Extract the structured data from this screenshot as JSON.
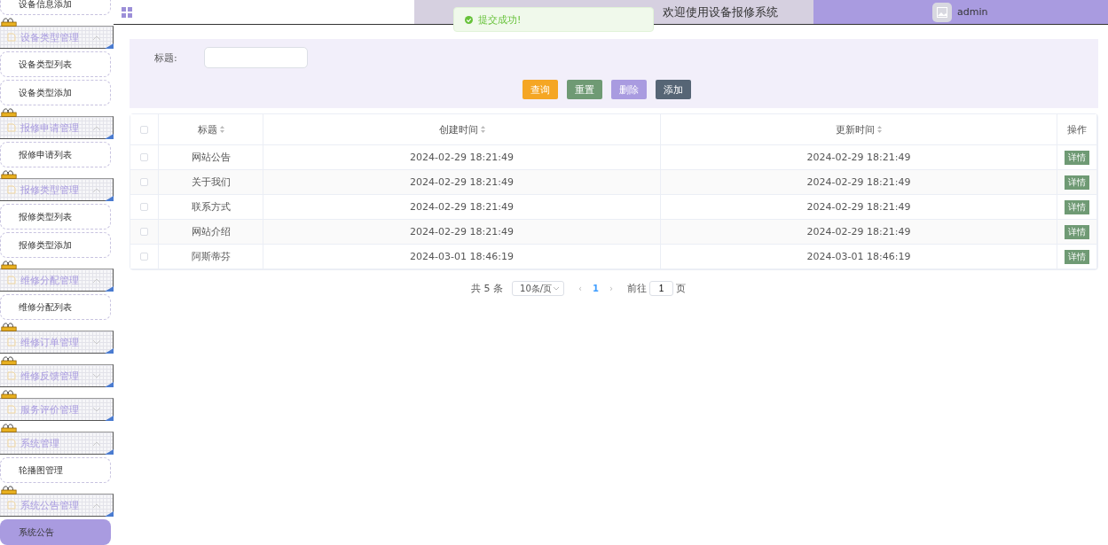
{
  "header": {
    "title": "欢迎使用设备报修系统",
    "user": "admin",
    "toast": "提交成功!"
  },
  "sidebar": [
    {
      "kind": "item",
      "label": "设备信息添加",
      "selected": false
    },
    {
      "kind": "group",
      "label": "设备类型管理",
      "expanded": true,
      "children": [
        {
          "kind": "item",
          "label": "设备类型列表",
          "selected": false
        },
        {
          "kind": "item",
          "label": "设备类型添加",
          "selected": false
        }
      ]
    },
    {
      "kind": "group",
      "label": "报修申请管理",
      "expanded": true,
      "children": [
        {
          "kind": "item",
          "label": "报修申请列表",
          "selected": false
        }
      ]
    },
    {
      "kind": "group",
      "label": "报修类型管理",
      "expanded": true,
      "children": [
        {
          "kind": "item",
          "label": "报修类型列表",
          "selected": false
        },
        {
          "kind": "item",
          "label": "报修类型添加",
          "selected": false
        }
      ]
    },
    {
      "kind": "group",
      "label": "维修分配管理",
      "expanded": true,
      "children": [
        {
          "kind": "item",
          "label": "维修分配列表",
          "selected": false
        }
      ]
    },
    {
      "kind": "group",
      "label": "维修订单管理",
      "expanded": false
    },
    {
      "kind": "group",
      "label": "维修反馈管理",
      "expanded": false
    },
    {
      "kind": "group",
      "label": "服务评价管理",
      "expanded": false
    },
    {
      "kind": "group",
      "label": "系统管理",
      "expanded": true,
      "children": [
        {
          "kind": "item",
          "label": "轮播图管理",
          "selected": false
        }
      ]
    },
    {
      "kind": "group",
      "label": "系统公告管理",
      "expanded": true,
      "children": [
        {
          "kind": "item",
          "label": "系统公告",
          "selected": true
        }
      ]
    }
  ],
  "search": {
    "label": "标题:",
    "buttons": [
      {
        "label": "查询",
        "kind": "query"
      },
      {
        "label": "重置",
        "kind": "reset"
      },
      {
        "label": "删除",
        "kind": "delete"
      },
      {
        "label": "添加",
        "kind": "add"
      }
    ]
  },
  "table": {
    "all_checked": false,
    "columns": [
      {
        "label": "标题",
        "sortable": true
      },
      {
        "label": "创建时间",
        "sortable": true
      },
      {
        "label": "更新时间",
        "sortable": true
      },
      {
        "label": "操作",
        "sortable": false
      }
    ],
    "rows": [
      {
        "checked": false,
        "title": "网站公告",
        "created": "2024-02-29 18:21:49",
        "updated": "2024-02-29 18:21:49",
        "action": "详情"
      },
      {
        "checked": false,
        "title": "关于我们",
        "created": "2024-02-29 18:21:49",
        "updated": "2024-02-29 18:21:49",
        "action": "详情"
      },
      {
        "checked": false,
        "title": "联系方式",
        "created": "2024-02-29 18:21:49",
        "updated": "2024-02-29 18:21:49",
        "action": "详情"
      },
      {
        "checked": false,
        "title": "网站介绍",
        "created": "2024-02-29 18:21:49",
        "updated": "2024-02-29 18:21:49",
        "action": "详情"
      },
      {
        "checked": false,
        "title": "阿斯蒂芬",
        "created": "2024-03-01 18:46:19",
        "updated": "2024-03-01 18:46:19",
        "action": "详情"
      }
    ]
  },
  "pagination": {
    "total": "共 5 条",
    "page_size": "10条/页",
    "prev": "‹",
    "pages": [
      {
        "label": "1",
        "selected": true
      }
    ],
    "next": "›",
    "goto_label": "前往",
    "goto_value": "1",
    "goto_unit": "页"
  }
}
